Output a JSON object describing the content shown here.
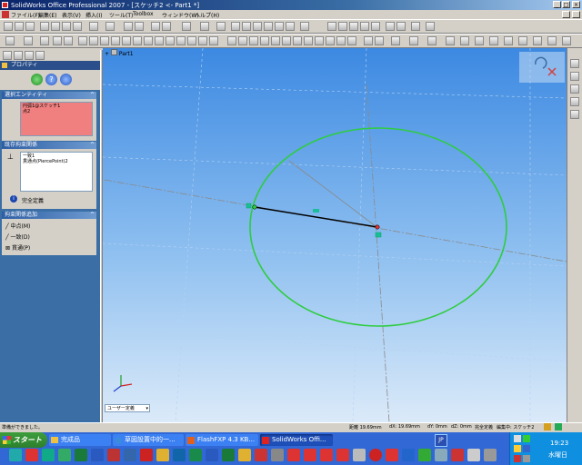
{
  "app": {
    "title": "SolidWorks Office Professional 2007 - [スケッチ2 <- Part1 *]",
    "win_controls": [
      "_",
      "□",
      "×"
    ]
  },
  "menu": [
    "ファイル(F)",
    "編集(E)",
    "表示(V)",
    "挿入(I)",
    "ツール(T)",
    "Toolbox",
    "ウィンドウ(W)",
    "ヘルプ(H)"
  ],
  "property_manager": {
    "title": "プロパティ",
    "sections": {
      "selected": {
        "title": "選択エンティティ",
        "items": [
          "円弧1@スケッチ1",
          "点2"
        ]
      },
      "existing": {
        "title": "既存拘束関係",
        "items": [
          "一致1",
          "貫通点(PiercePoint)2"
        ],
        "status": "完全定義"
      },
      "add": {
        "title": "拘束関係追加",
        "items": [
          "中点(M)",
          "一致(D)",
          "貫通(P)"
        ]
      }
    }
  },
  "viewport": {
    "tree_label": "Part1",
    "view_dropdown": "ユーザー定義",
    "colors": {
      "circle": "#2ecc40",
      "line": "#000000",
      "axis": "#8a8a8a"
    }
  },
  "status": {
    "left": "準備ができました。",
    "distance": "距離 19.69mm",
    "dx": "dX: 19.69mm",
    "dy": "dY: 0mm",
    "dz": "dZ: 0mm",
    "state": "完全定義",
    "edit": "編集中: スケッチ2"
  },
  "taskbar": {
    "start": "スタート",
    "buttons": [
      "完成品",
      "草図設置中的一...",
      "FlashFXP 4.3 KB...",
      "SolidWorks Offi..."
    ],
    "lang": "JP",
    "time": "19:23",
    "day": "水曜日"
  }
}
